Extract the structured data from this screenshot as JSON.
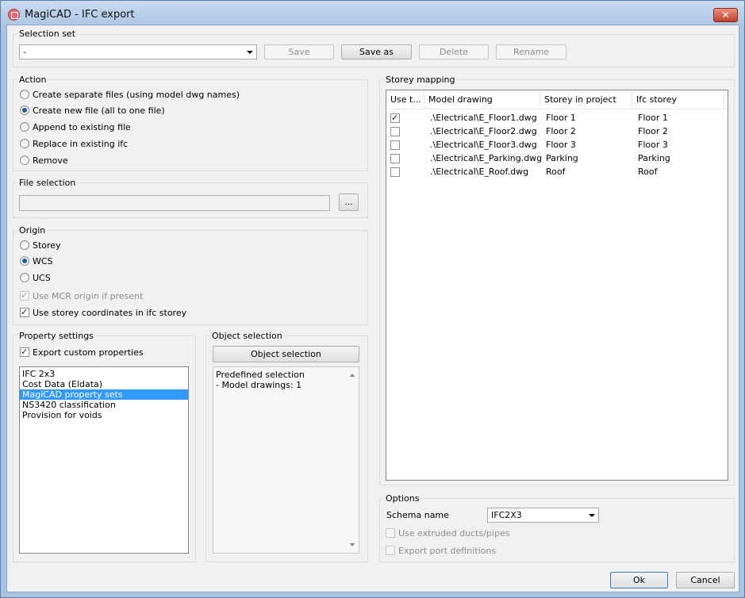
{
  "window": {
    "title": "MagiCAD - IFC export",
    "close_label": "✕"
  },
  "selection_set": {
    "label": "Selection set",
    "value": "-",
    "buttons": {
      "save": "Save",
      "save_as": "Save as",
      "delete": "Delete",
      "rename": "Rename"
    }
  },
  "action": {
    "label": "Action",
    "options": [
      {
        "label": "Create separate files (using model dwg names)",
        "selected": false
      },
      {
        "label": "Create new file (all to one file)",
        "selected": true
      },
      {
        "label": "Append to existing file",
        "selected": false
      },
      {
        "label": "Replace in existing ifc",
        "selected": false
      },
      {
        "label": "Remove",
        "selected": false
      }
    ]
  },
  "file_selection": {
    "label": "File selection",
    "value": "",
    "browse_label": "..."
  },
  "origin": {
    "label": "Origin",
    "options": [
      {
        "label": "Storey",
        "selected": false
      },
      {
        "label": "WCS",
        "selected": true
      },
      {
        "label": "UCS",
        "selected": false
      }
    ],
    "use_mcr_origin": {
      "label": "Use MCR origin if present",
      "checked": true,
      "enabled": false
    },
    "use_storey_coordinates": {
      "label": "Use storey coordinates in ifc storey",
      "checked": true
    }
  },
  "property_settings": {
    "label": "Property settings",
    "export_custom": {
      "label": "Export custom properties",
      "checked": true
    },
    "items": [
      "IFC 2x3",
      "Cost Data (Eldata)",
      "MagiCAD property sets",
      "NS3420 classification",
      "Provision for voids"
    ],
    "selected_index": 2
  },
  "object_selection": {
    "label": "Object selection",
    "button_label": "Object selection",
    "lines": [
      "Predefined selection",
      "- Model drawings: 1"
    ]
  },
  "storey_mapping": {
    "label": "Storey mapping",
    "columns": [
      "Use t...",
      "Model drawing",
      "Storey in project",
      "Ifc storey"
    ],
    "rows": [
      {
        "use": true,
        "drawing": ".\\Electrical\\E_Floor1.dwg",
        "storey": "Floor 1",
        "ifc": "Floor 1"
      },
      {
        "use": false,
        "drawing": ".\\Electrical\\E_Floor2.dwg",
        "storey": "Floor 2",
        "ifc": "Floor 2"
      },
      {
        "use": false,
        "drawing": ".\\Electrical\\E_Floor3.dwg",
        "storey": "Floor 3",
        "ifc": "Floor 3"
      },
      {
        "use": false,
        "drawing": ".\\Electrical\\E_Parking.dwg",
        "storey": "Parking",
        "ifc": "Parking"
      },
      {
        "use": false,
        "drawing": ".\\Electrical\\E_Roof.dwg",
        "storey": "Roof",
        "ifc": "Roof"
      }
    ]
  },
  "options": {
    "label": "Options",
    "schema_label": "Schema name",
    "schema_value": "IFC2X3",
    "use_extruded": {
      "label": "Use extruded ducts/pipes",
      "checked": false,
      "enabled": false
    },
    "export_ports": {
      "label": "Export port definitions",
      "checked": false,
      "enabled": false
    }
  },
  "footer": {
    "ok_label": "Ok",
    "cancel_label": "Cancel"
  }
}
